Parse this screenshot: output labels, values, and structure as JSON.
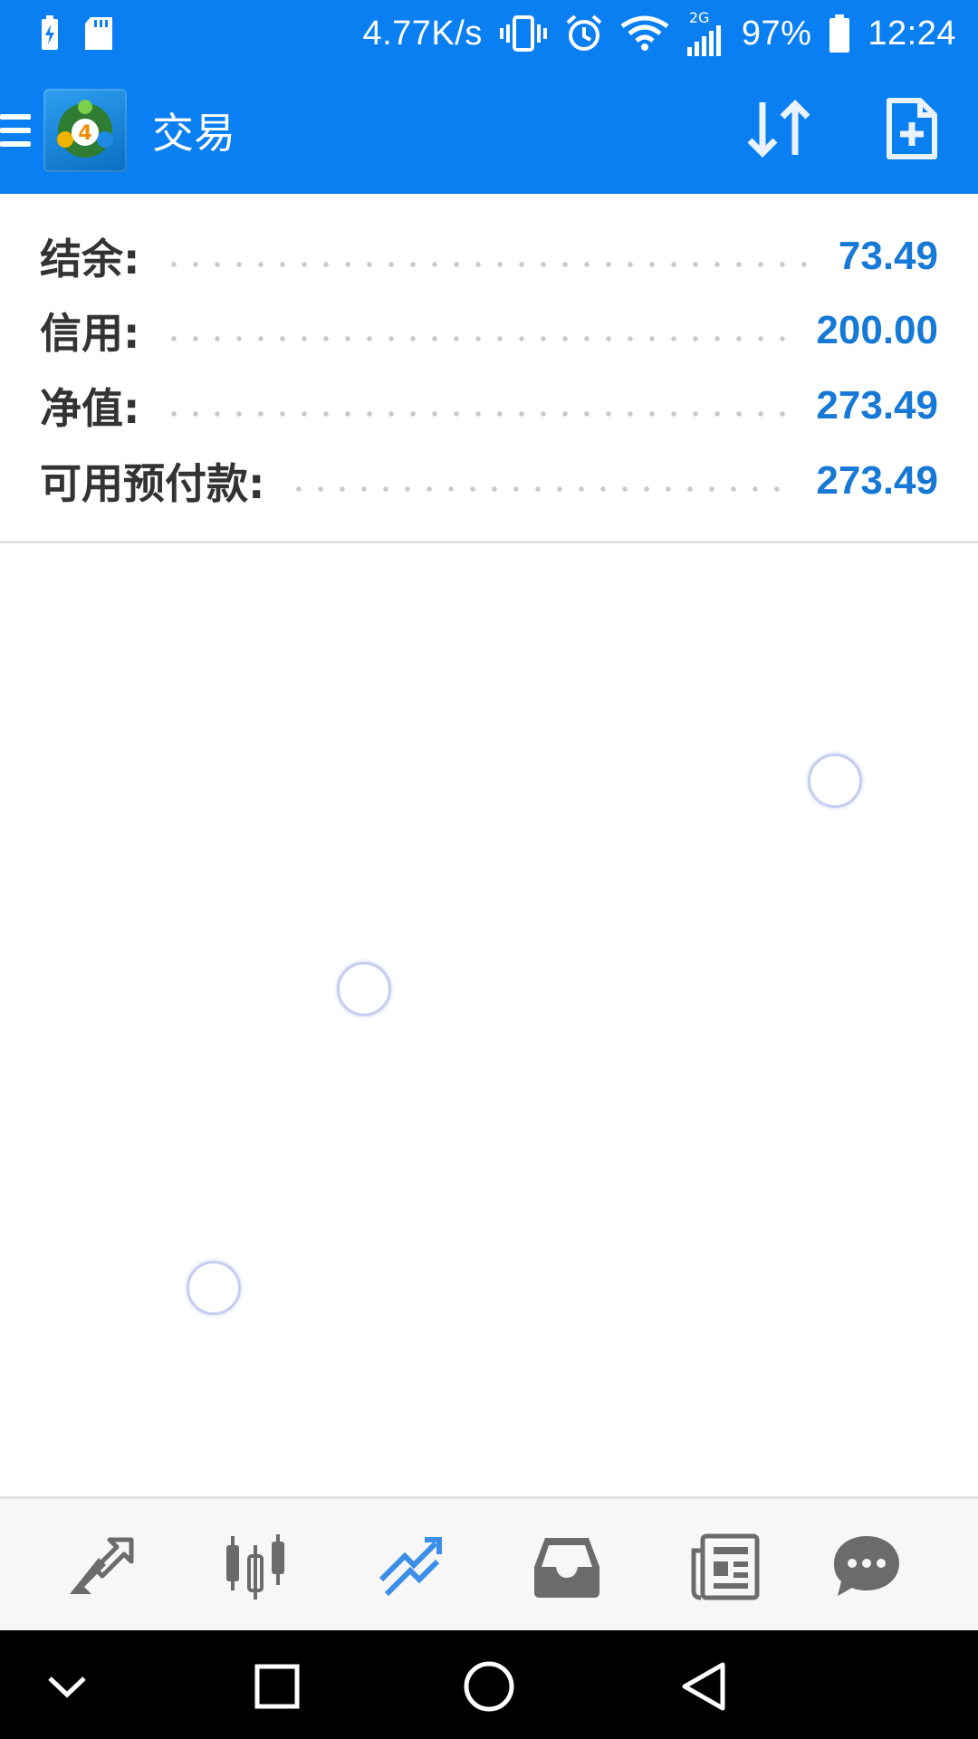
{
  "status_bar": {
    "network_speed": "4.77K/s",
    "network_type": "2G",
    "battery": "97%",
    "time": "12:24",
    "icons": [
      "battery-charging-icon",
      "sd-card-icon",
      "vibrate-icon",
      "alarm-icon",
      "wifi-icon",
      "signal-icon",
      "battery-icon"
    ]
  },
  "app_bar": {
    "title": "交易",
    "logo_digit": "4",
    "actions": [
      "sort-icon",
      "new-order-icon"
    ]
  },
  "account": {
    "rows": [
      {
        "label": "结余:",
        "value": "73.49"
      },
      {
        "label": "信用:",
        "value": "200.00"
      },
      {
        "label": "净值:",
        "value": "273.49"
      },
      {
        "label": "可用预付款:",
        "value": "273.49"
      }
    ]
  },
  "bottom_tabs": [
    {
      "icon": "quotes-icon",
      "active": false
    },
    {
      "icon": "chart-candles-icon",
      "active": false
    },
    {
      "icon": "trade-icon",
      "active": true
    },
    {
      "icon": "history-inbox-icon",
      "active": false
    },
    {
      "icon": "news-icon",
      "active": false
    },
    {
      "icon": "chat-icon",
      "active": false
    }
  ],
  "colors": {
    "primary": "#0a7ff2",
    "value_blue": "#1679d6",
    "tab_active": "#3c8ee8",
    "tab_inactive": "#6b6b6b"
  }
}
